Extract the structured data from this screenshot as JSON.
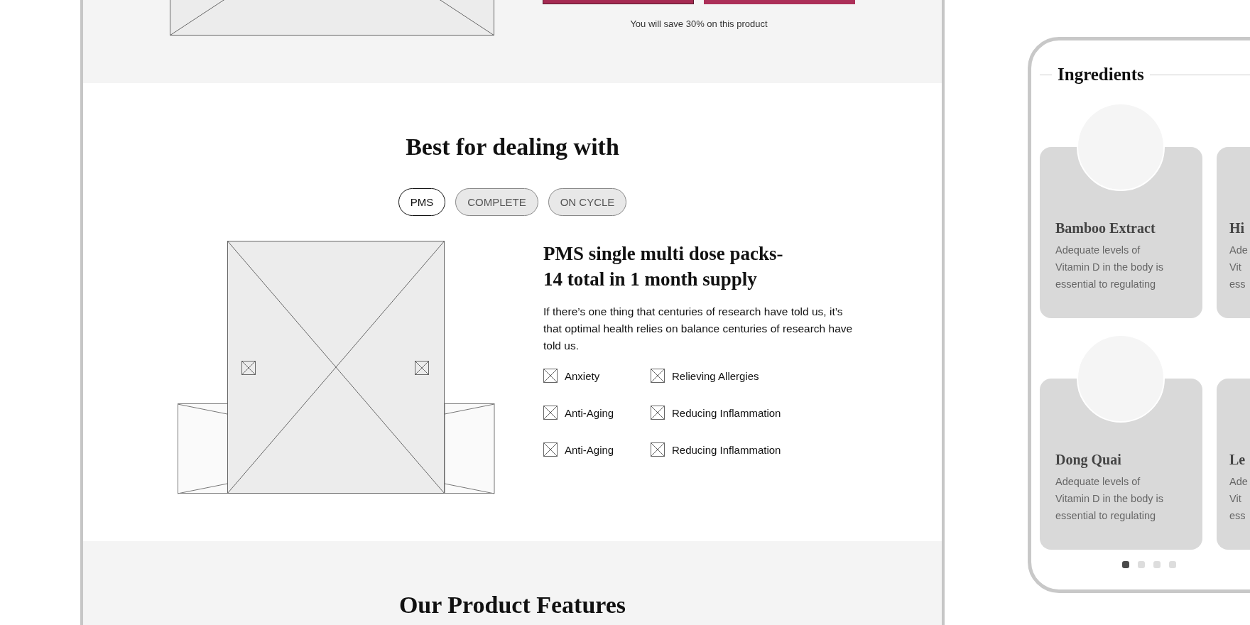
{
  "offer": {
    "buttons": [
      {
        "kind": "outline"
      },
      {
        "kind": "filled"
      }
    ],
    "savings_note": "You will save 30% on this product"
  },
  "best_for": {
    "title": "Best for dealing with",
    "tabs": [
      {
        "label": "PMS",
        "selected": true
      },
      {
        "label": "COMPLETE",
        "selected": false
      },
      {
        "label": "ON CYCLE",
        "selected": false
      }
    ],
    "product": {
      "heading_lines": [
        "PMS single multi dose packs-",
        "14 total in 1 month supply"
      ],
      "description": "If there’s one thing that centuries of research have told us, it’s that optimal health relies on balance centuries of research have told us.",
      "benefits": [
        "Anxiety",
        "Relieving Allergies",
        "Anti-Aging",
        "Reducing Inflammation",
        "Anti-Aging",
        "Reducing Inflammation"
      ]
    }
  },
  "features": {
    "title": "Our Product Features"
  },
  "phone": {
    "ingredients": {
      "title": "Ingredients",
      "cards": [
        {
          "kind": "full",
          "name": "Bamboo Extract",
          "description_lines": [
            "Adequate levels of",
            "Vitamin D in the body is",
            "essential to regulating"
          ]
        },
        {
          "kind": "cut",
          "name": "Hi",
          "description_lines": [
            "Ade",
            "Vit",
            "ess"
          ]
        },
        {
          "kind": "full",
          "name": "Dong Quai",
          "description_lines": [
            "Adequate levels of",
            "Vitamin D in the body is",
            "essential to regulating"
          ]
        },
        {
          "kind": "cut",
          "name": "Le",
          "description_lines": [
            "Ade",
            "Vit",
            "ess"
          ]
        }
      ],
      "dots": [
        {
          "selected": true
        },
        {
          "selected": false
        },
        {
          "selected": false
        },
        {
          "selected": false
        }
      ]
    }
  }
}
